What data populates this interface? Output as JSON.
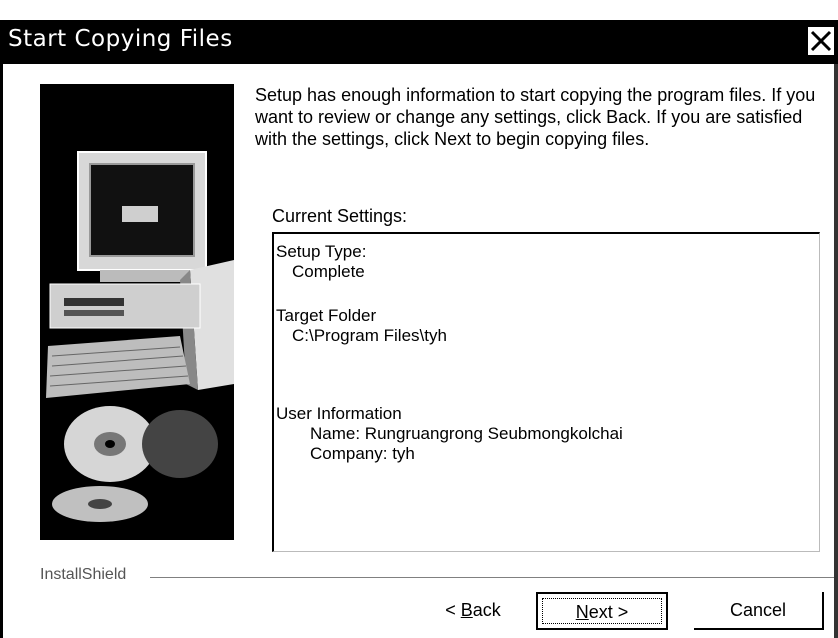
{
  "window": {
    "title": "Start Copying Files",
    "close_icon": "close-x-icon"
  },
  "intro_text": "Setup has enough information to start copying the program files. If you want to review or change any settings, click Back.  If you are satisfied with the settings, click Next to begin copying files.",
  "current_settings": {
    "label": "Current Settings:",
    "setup_type_label": "Setup Type:",
    "setup_type_value": "Complete",
    "target_folder_label": "Target Folder",
    "target_folder_value": "C:\\Program Files\\tyh",
    "user_info_label": "User Information",
    "name_line": "Name:  Rungruangrong Seubmongkolchai",
    "company_line": "Company:  tyh"
  },
  "branding": {
    "label": "InstallShield"
  },
  "buttons": {
    "back_prefix": "< ",
    "back_accel": "B",
    "back_rest": "ack",
    "next_accel": "N",
    "next_rest": "ext >",
    "cancel_label": "Cancel"
  },
  "artwork": {
    "icon": "computer-and-cd-illustration"
  }
}
